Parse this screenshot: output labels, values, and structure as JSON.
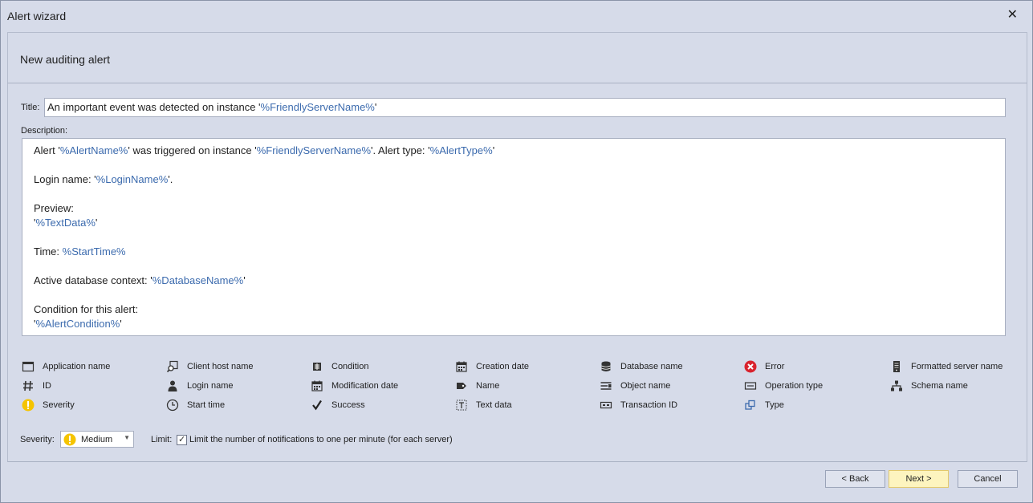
{
  "window": {
    "title": "Alert wizard",
    "close_glyph": "✕"
  },
  "header": {
    "title": "New auditing alert"
  },
  "form": {
    "title_label": "Title:",
    "title_parts": [
      {
        "text": "An important event was detected on instance '",
        "var": false
      },
      {
        "text": "%FriendlyServerName%",
        "var": true
      },
      {
        "text": "'",
        "var": false
      }
    ],
    "description_label": "Description:",
    "description_lines": [
      [
        {
          "text": "Alert '",
          "var": false
        },
        {
          "text": "%AlertName%",
          "var": true
        },
        {
          "text": "' was triggered on instance '",
          "var": false
        },
        {
          "text": "%FriendlyServerName%",
          "var": true
        },
        {
          "text": "'. Alert type: '",
          "var": false
        },
        {
          "text": "%AlertType%",
          "var": true
        },
        {
          "text": "'",
          "var": false
        }
      ],
      [],
      [
        {
          "text": "Login name: '",
          "var": false
        },
        {
          "text": "%LoginName%",
          "var": true
        },
        {
          "text": "'.",
          "var": false
        }
      ],
      [],
      [
        {
          "text": "Preview:",
          "var": false
        }
      ],
      [
        {
          "text": "'",
          "var": false
        },
        {
          "text": "%TextData%",
          "var": true
        },
        {
          "text": "'",
          "var": false
        }
      ],
      [],
      [
        {
          "text": "Time: ",
          "var": false
        },
        {
          "text": "%StartTime%",
          "var": true
        }
      ],
      [],
      [
        {
          "text": "Active database context: '",
          "var": false
        },
        {
          "text": "%DatabaseName%",
          "var": true
        },
        {
          "text": "'",
          "var": false
        }
      ],
      [],
      [
        {
          "text": "Condition for this alert:",
          "var": false
        }
      ],
      [
        {
          "text": "'",
          "var": false
        },
        {
          "text": "%AlertCondition%",
          "var": true
        },
        {
          "text": "'",
          "var": false
        }
      ]
    ]
  },
  "legend": [
    [
      {
        "label": "Application name",
        "icon": "window-icon"
      },
      {
        "label": "ID",
        "icon": "hash-icon"
      },
      {
        "label": "Severity",
        "icon": "warning-icon"
      }
    ],
    [
      {
        "label": "Client host name",
        "icon": "host-search-icon"
      },
      {
        "label": "Login name",
        "icon": "user-icon"
      },
      {
        "label": "Start time",
        "icon": "clock-icon"
      }
    ],
    [
      {
        "label": "Condition",
        "icon": "condition-icon"
      },
      {
        "label": "Modification date",
        "icon": "calendar-icon"
      },
      {
        "label": "Success",
        "icon": "checkmark-icon"
      }
    ],
    [
      {
        "label": "Creation date",
        "icon": "calendar-icon"
      },
      {
        "label": "Name",
        "icon": "tag-icon"
      },
      {
        "label": "Text data",
        "icon": "text-data-icon"
      }
    ],
    [
      {
        "label": "Database name",
        "icon": "database-icon"
      },
      {
        "label": "Object name",
        "icon": "object-icon"
      },
      {
        "label": "Transaction ID",
        "icon": "transaction-icon"
      }
    ],
    [
      {
        "label": "Error",
        "icon": "error-icon"
      },
      {
        "label": "Operation type",
        "icon": "operation-icon"
      },
      {
        "label": "Type",
        "icon": "type-icon"
      }
    ],
    [
      {
        "label": "Formatted server name",
        "icon": "server-icon"
      },
      {
        "label": "Schema name",
        "icon": "schema-icon"
      }
    ]
  ],
  "severity": {
    "label": "Severity:",
    "value": "Medium",
    "icon": "warning-icon"
  },
  "limit": {
    "label": "Limit:",
    "checkbox_label": "Limit the number of notifications to one per minute (for each server)",
    "checked": true,
    "check_glyph": "✓"
  },
  "buttons": {
    "back": "< Back",
    "next": "Next >",
    "cancel": "Cancel"
  },
  "colors": {
    "variable": "#3c6bae",
    "background": "#d6dbe9",
    "error": "#d9232e",
    "warning": "#f5c400",
    "primary_button": "#fdf4bf"
  }
}
